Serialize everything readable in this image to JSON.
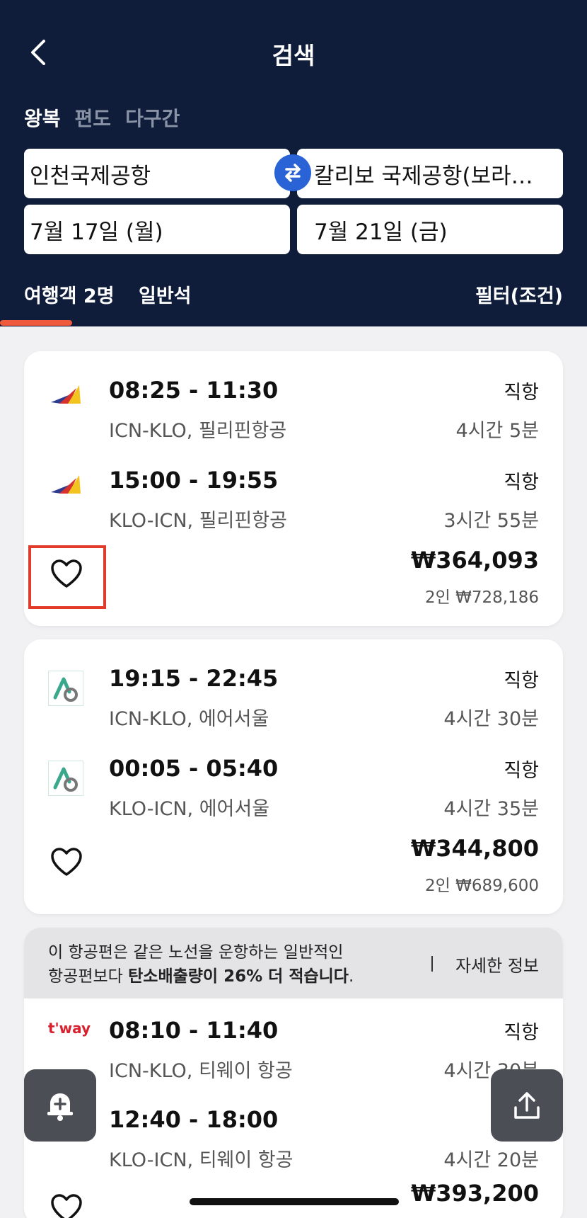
{
  "header": {
    "title": "검색",
    "trip_tabs": [
      "왕복",
      "편도",
      "다구간"
    ],
    "origin": "인천국제공항",
    "destination": "칼리보 국제공항(보라…",
    "depart_date": "7월 17일 (월)",
    "return_date": "7월 21일 (금)",
    "passengers": "여행객 2명",
    "cabin": "일반석",
    "filter": "필터(조건)"
  },
  "results": [
    {
      "logo_icon": "philippine-airlines-logo",
      "outbound": {
        "time": "08:25 - 11:30",
        "route": "ICN-KLO, 필리핀항공",
        "stops": "직항",
        "duration": "4시간 5분"
      },
      "inbound": {
        "time": "15:00 - 19:55",
        "route": "KLO-ICN, 필리핀항공",
        "stops": "직항",
        "duration": "3시간 55분"
      },
      "price": "₩364,093",
      "total": "2인 ₩728,186"
    },
    {
      "logo_icon": "air-seoul-logo",
      "outbound": {
        "time": "19:15 - 22:45",
        "route": "ICN-KLO, 에어서울",
        "stops": "직항",
        "duration": "4시간 30분"
      },
      "inbound": {
        "time": "00:05 - 05:40",
        "route": "KLO-ICN, 에어서울",
        "stops": "직항",
        "duration": "4시간 35분"
      },
      "price": "₩344,800",
      "total": "2인 ₩689,600"
    },
    {
      "logo_icon": "tway-logo",
      "logo_text": "t'way",
      "eco_note_plain": "이 항공편은 같은 노선을 운항하는 일반적인",
      "eco_note_line2_plain": "항공편보다 ",
      "eco_note_bold": "탄소배출량이 26% 더 적습니다",
      "eco_note_end": ".",
      "eco_link": "자세한 정보",
      "outbound": {
        "time": "08:10 - 11:40",
        "route": "ICN-KLO, 티웨이 항공",
        "stops": "직항",
        "duration": "4시간 30분"
      },
      "inbound": {
        "time": "12:40 - 18:00",
        "route": "KLO-ICN, 티웨이 항공",
        "stops": "",
        "duration": "4시간 20분"
      },
      "price": "₩393,200"
    }
  ],
  "colors": {
    "header_bg": "#0f1d3a",
    "accent": "#ef5a3c",
    "swap_blue": "#2a63d6",
    "highlight_red": "#e23b2a"
  }
}
